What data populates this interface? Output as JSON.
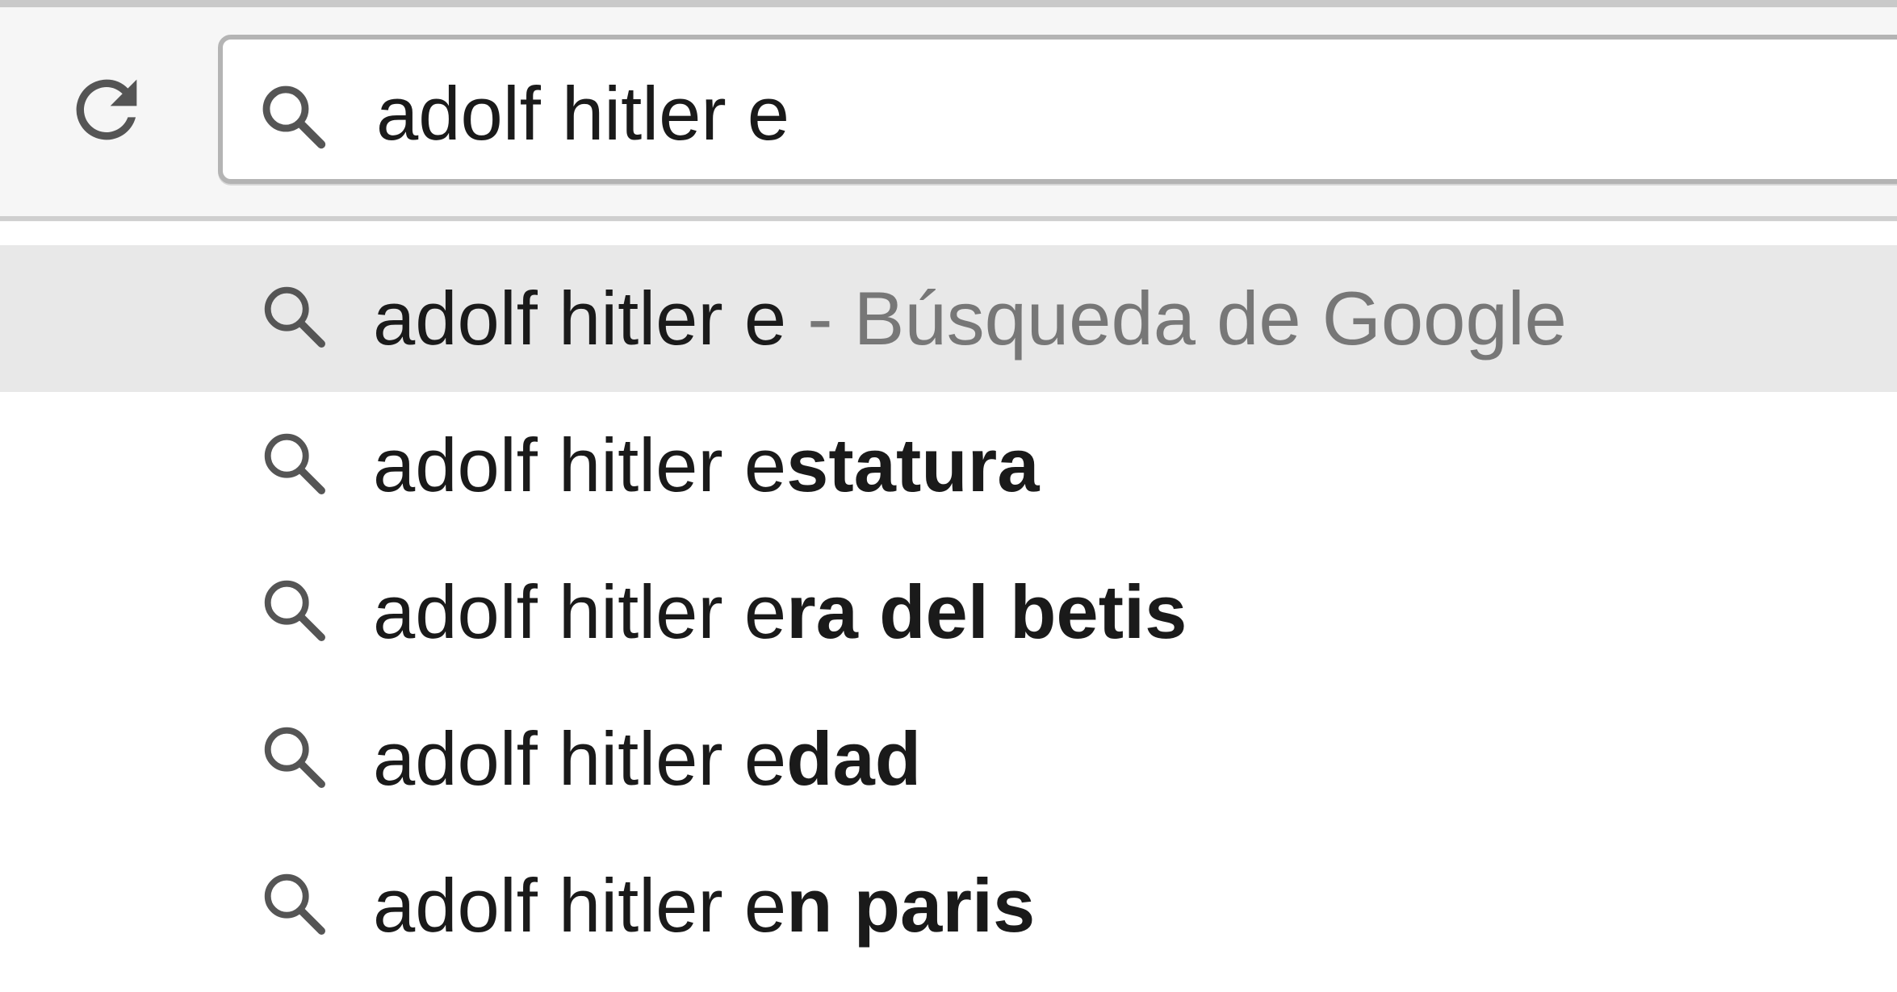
{
  "toolbar": {
    "reload_icon": "reload-icon",
    "search_icon": "search-icon"
  },
  "omnibox": {
    "value": "adolf hitler e"
  },
  "suggestions": [
    {
      "typed": "adolf hitler ",
      "prefix": "e",
      "completion": "",
      "description": " - Búsqueda de Google",
      "icon": "search-icon",
      "selected": true
    },
    {
      "typed": "adolf hitler ",
      "prefix": "e",
      "completion": "statura",
      "description": "",
      "icon": "search-icon",
      "selected": false
    },
    {
      "typed": "adolf hitler ",
      "prefix": "e",
      "completion": "ra del betis",
      "description": "",
      "icon": "search-icon",
      "selected": false
    },
    {
      "typed": "adolf hitler ",
      "prefix": "e",
      "completion": "dad",
      "description": "",
      "icon": "search-icon",
      "selected": false
    },
    {
      "typed": "adolf hitler ",
      "prefix": "e",
      "completion": "n paris",
      "description": "",
      "icon": "search-icon",
      "selected": false
    }
  ],
  "colors": {
    "toolbar_bg": "#f6f6f6",
    "selected_row": "#e8e8e8",
    "description_text": "#777777",
    "icon": "#555555"
  }
}
